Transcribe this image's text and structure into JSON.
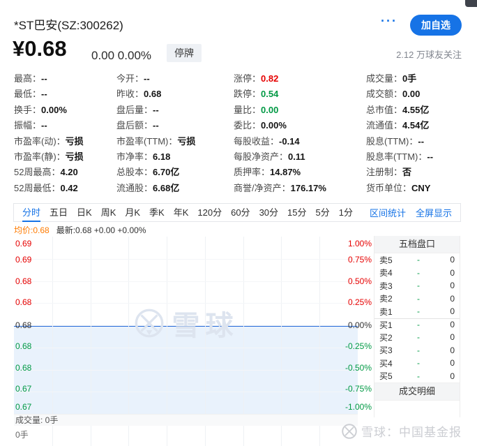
{
  "header": {
    "title": "*ST巴安(SZ:300262)",
    "more_button": "···",
    "follow_button": "加自选",
    "price": "¥0.68",
    "change": "0.00 0.00%",
    "status_badge": "停牌",
    "followers": "2.12 万球友关注"
  },
  "stats": {
    "cells": [
      {
        "label": "最高：",
        "value": "--"
      },
      {
        "label": "今开：",
        "value": "--"
      },
      {
        "label": "涨停：",
        "value": "0.82",
        "color": "red"
      },
      {
        "label": "成交量：",
        "value": "0手"
      },
      {
        "label": "最低：",
        "value": "--"
      },
      {
        "label": "昨收：",
        "value": "0.68"
      },
      {
        "label": "跌停：",
        "value": "0.54",
        "color": "green"
      },
      {
        "label": "成交额：",
        "value": "0.00"
      },
      {
        "label": "换手：",
        "value": "0.00%"
      },
      {
        "label": "盘后量：",
        "value": "--"
      },
      {
        "label": "量比：",
        "value": "0.00",
        "color": "green"
      },
      {
        "label": "总市值：",
        "value": "4.55亿"
      },
      {
        "label": "振幅：",
        "value": "--"
      },
      {
        "label": "盘后额：",
        "value": "--"
      },
      {
        "label": "委比：",
        "value": "0.00%"
      },
      {
        "label": "流通值：",
        "value": "4.54亿"
      },
      {
        "label": "市盈率(动)：",
        "value": "亏损"
      },
      {
        "label": "市盈率(TTM)：",
        "value": "亏损"
      },
      {
        "label": "每股收益：",
        "value": "-0.14"
      },
      {
        "label": "股息(TTM)：",
        "value": "--"
      },
      {
        "label": "市盈率(静)：",
        "value": "亏损"
      },
      {
        "label": "市净率：",
        "value": "6.18"
      },
      {
        "label": "每股净资产：",
        "value": "0.11"
      },
      {
        "label": "股息率(TTM)：",
        "value": "--"
      },
      {
        "label": "52周最高：",
        "value": "4.20"
      },
      {
        "label": "总股本：",
        "value": "6.70亿"
      },
      {
        "label": "质押率：",
        "value": "14.87%"
      },
      {
        "label": "注册制：",
        "value": "否"
      },
      {
        "label": "52周最低：",
        "value": "0.42"
      },
      {
        "label": "流通股：",
        "value": "6.68亿"
      },
      {
        "label": "商誉/净资产：",
        "value": "176.17%"
      },
      {
        "label": "货币单位：",
        "value": "CNY"
      }
    ]
  },
  "tabs": {
    "items": [
      "分时",
      "五日",
      "日K",
      "周K",
      "月K",
      "季K",
      "年K",
      "120分",
      "60分",
      "30分",
      "15分",
      "5分",
      "1分"
    ],
    "active": "分时",
    "right_links": [
      "区间统计",
      "全屏显示"
    ]
  },
  "ticker": {
    "avg": "均价:0.68",
    "latest": "最新:0.68 +0.00 +0.00%"
  },
  "chart_data": {
    "type": "line",
    "title": "分时",
    "baseline_price": 0.68,
    "series": [
      {
        "name": "价格",
        "values": [
          0.68,
          0.68
        ]
      }
    ],
    "y_axis_left_prices": [
      "0.69",
      "0.69",
      "0.68",
      "0.68",
      "0.68",
      "0.68",
      "0.68",
      "0.67",
      "0.67"
    ],
    "y_axis_right_percent": [
      "1.00%",
      "0.75%",
      "0.50%",
      "0.25%",
      "0.00%",
      "-0.25%",
      "-0.50%",
      "-0.75%",
      "-1.00%"
    ],
    "ylim_percent": [
      -1.0,
      1.0
    ],
    "grid": "on",
    "volume_values": [
      0
    ]
  },
  "order_book": {
    "title": "五档盘口",
    "rows": [
      {
        "name": "卖5",
        "price": "-",
        "volume": "0"
      },
      {
        "name": "卖4",
        "price": "-",
        "volume": "0"
      },
      {
        "name": "卖3",
        "price": "-",
        "volume": "0"
      },
      {
        "name": "卖2",
        "price": "-",
        "volume": "0"
      },
      {
        "name": "卖1",
        "price": "-",
        "volume": "0"
      },
      {
        "name": "买1",
        "price": "-",
        "volume": "0"
      },
      {
        "name": "买2",
        "price": "-",
        "volume": "0"
      },
      {
        "name": "买3",
        "price": "-",
        "volume": "0"
      },
      {
        "name": "买4",
        "price": "-",
        "volume": "0"
      },
      {
        "name": "买5",
        "price": "-",
        "volume": "0"
      }
    ],
    "detail_title": "成交明细"
  },
  "volume_pane": {
    "label": "成交量: 0手",
    "axis_label": "0手"
  },
  "watermarks": {
    "chart": "雪球",
    "footer": "雪球：中国基金报"
  },
  "colors": {
    "red": "#e60000",
    "green": "#009944",
    "accent": "#1673e6",
    "orange": "#ff7b00",
    "chart-line": "#2468d8",
    "chart-fill": "#e9f2fc"
  }
}
